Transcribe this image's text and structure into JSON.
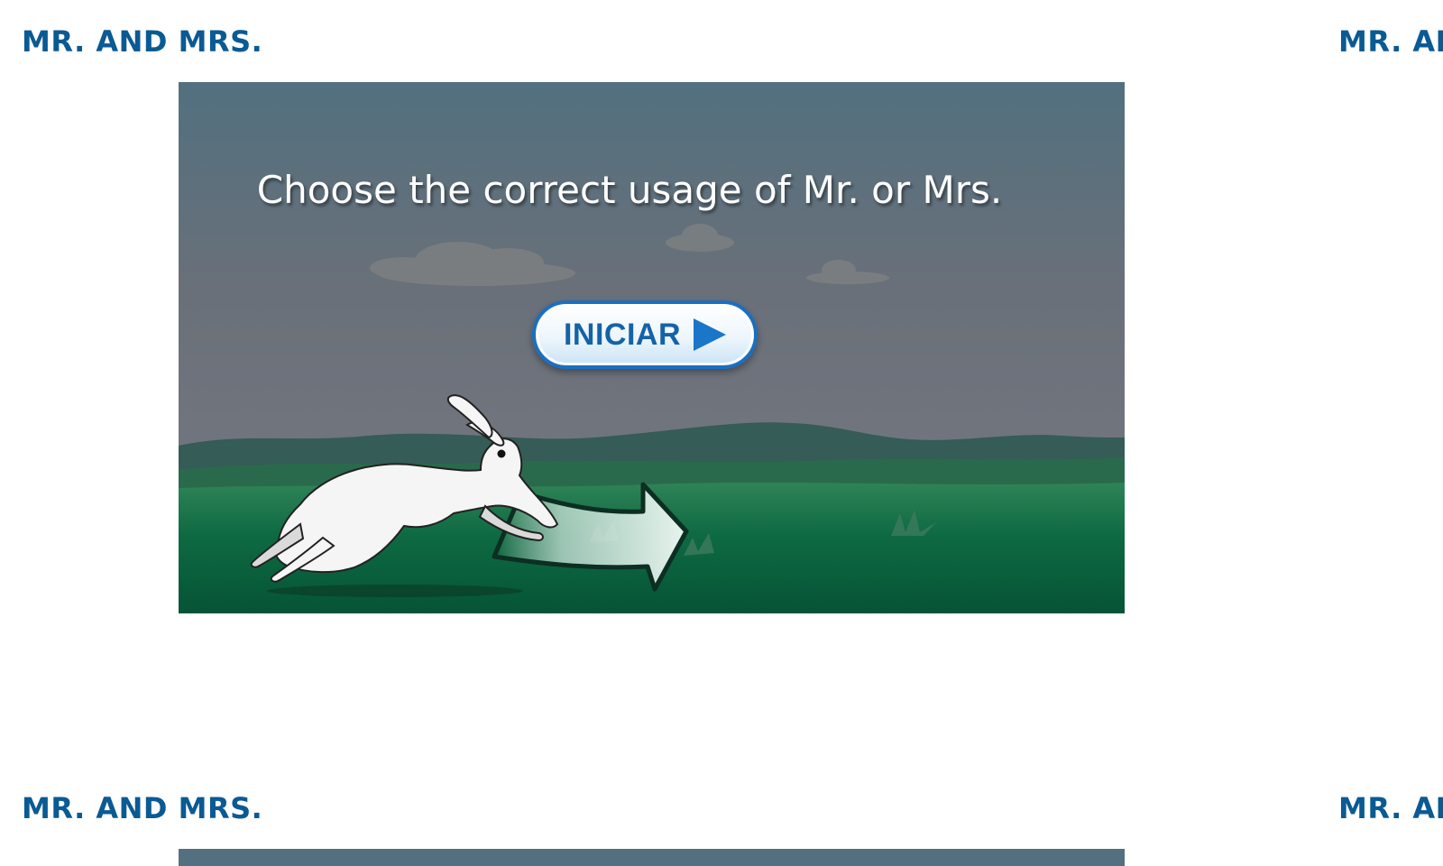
{
  "sections": [
    {
      "title": "MR. AND MRS."
    },
    {
      "title": "MR. AND MRS."
    },
    {
      "title": "MR. AND MRS."
    },
    {
      "title": "MR. AND MRS."
    }
  ],
  "game": {
    "instruction": "Choose the correct usage of Mr. or Mrs.",
    "start_button": {
      "label": "INICIAR",
      "icon": "play-icon"
    }
  },
  "colors": {
    "title": "#0a5a94",
    "sky": "#6a7079",
    "grass": "#0b5a38",
    "button_border": "#1b6fc1",
    "button_text": "#1463a8"
  }
}
